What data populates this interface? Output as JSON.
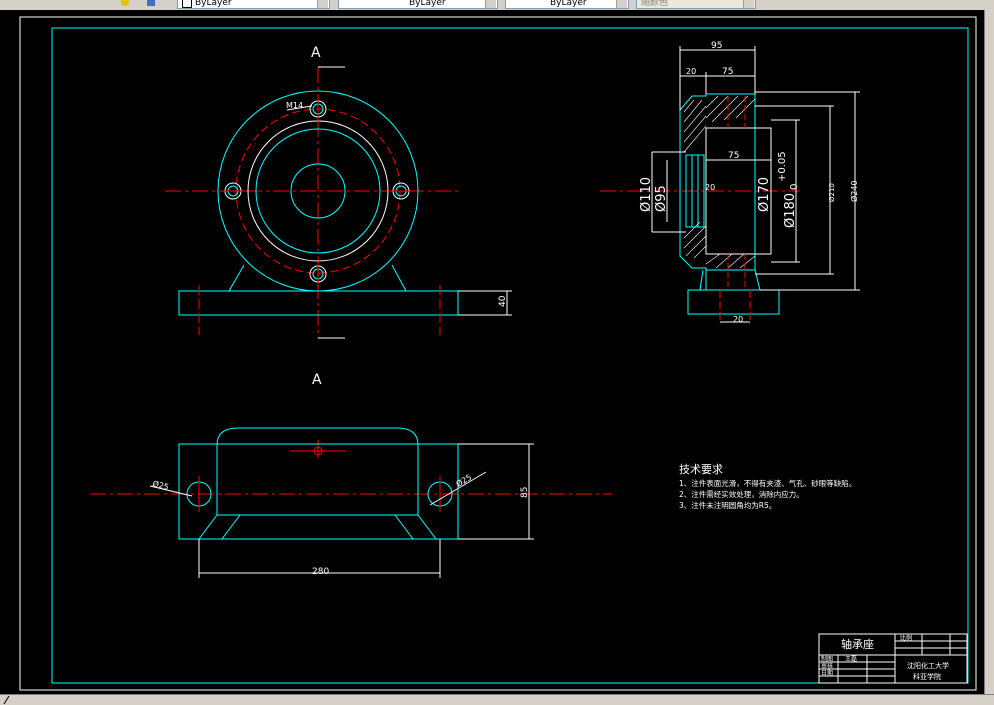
{
  "toolbar": {
    "color_value": "ByLayer",
    "linetype_value": "ByLayer",
    "lineweight_value": "ByLayer",
    "plotstyle_value": "随颜色"
  },
  "drawing": {
    "view_label_top": "A",
    "view_label_bottom": "A",
    "dims": {
      "m14": "M14",
      "d40": "40",
      "d95": "95",
      "d20_top": "20",
      "d75_top": "75",
      "d75_inner": "75",
      "d20_inner": "20",
      "d20_bottom": "20",
      "phi110": "Ø110",
      "phi95": "Ø95",
      "phi170": "Ø170",
      "phi180": "Ø180",
      "phi180_tol_upper": "+0.05",
      "phi180_tol_lower": "0",
      "phi210": "Ø210",
      "phi240": "Ø240",
      "phi25_left": "Ø25",
      "phi25_right": "Ø25",
      "d280": "280",
      "d85": "85"
    },
    "tech_requirements": {
      "title": "技术要求",
      "items": [
        "1、注件表面光滑，不得有夹渣、气孔、砂眼等缺陷。",
        "2、注件需经实效处理，消除内应力。",
        "3、注件未注明圆角均为R5。"
      ]
    },
    "title_block": {
      "part_name": "轴承座",
      "scale_label": "比例",
      "row1_label": "制图",
      "row1_name": "王磊",
      "row2_label": "审核",
      "row3_label": "日期",
      "school": "沈阳化工大学",
      "dept": "科亚学院"
    }
  },
  "colors": {
    "background": "#000000",
    "outline": "#00ffff",
    "centerline": "#ff0000",
    "text": "#ffffff"
  }
}
